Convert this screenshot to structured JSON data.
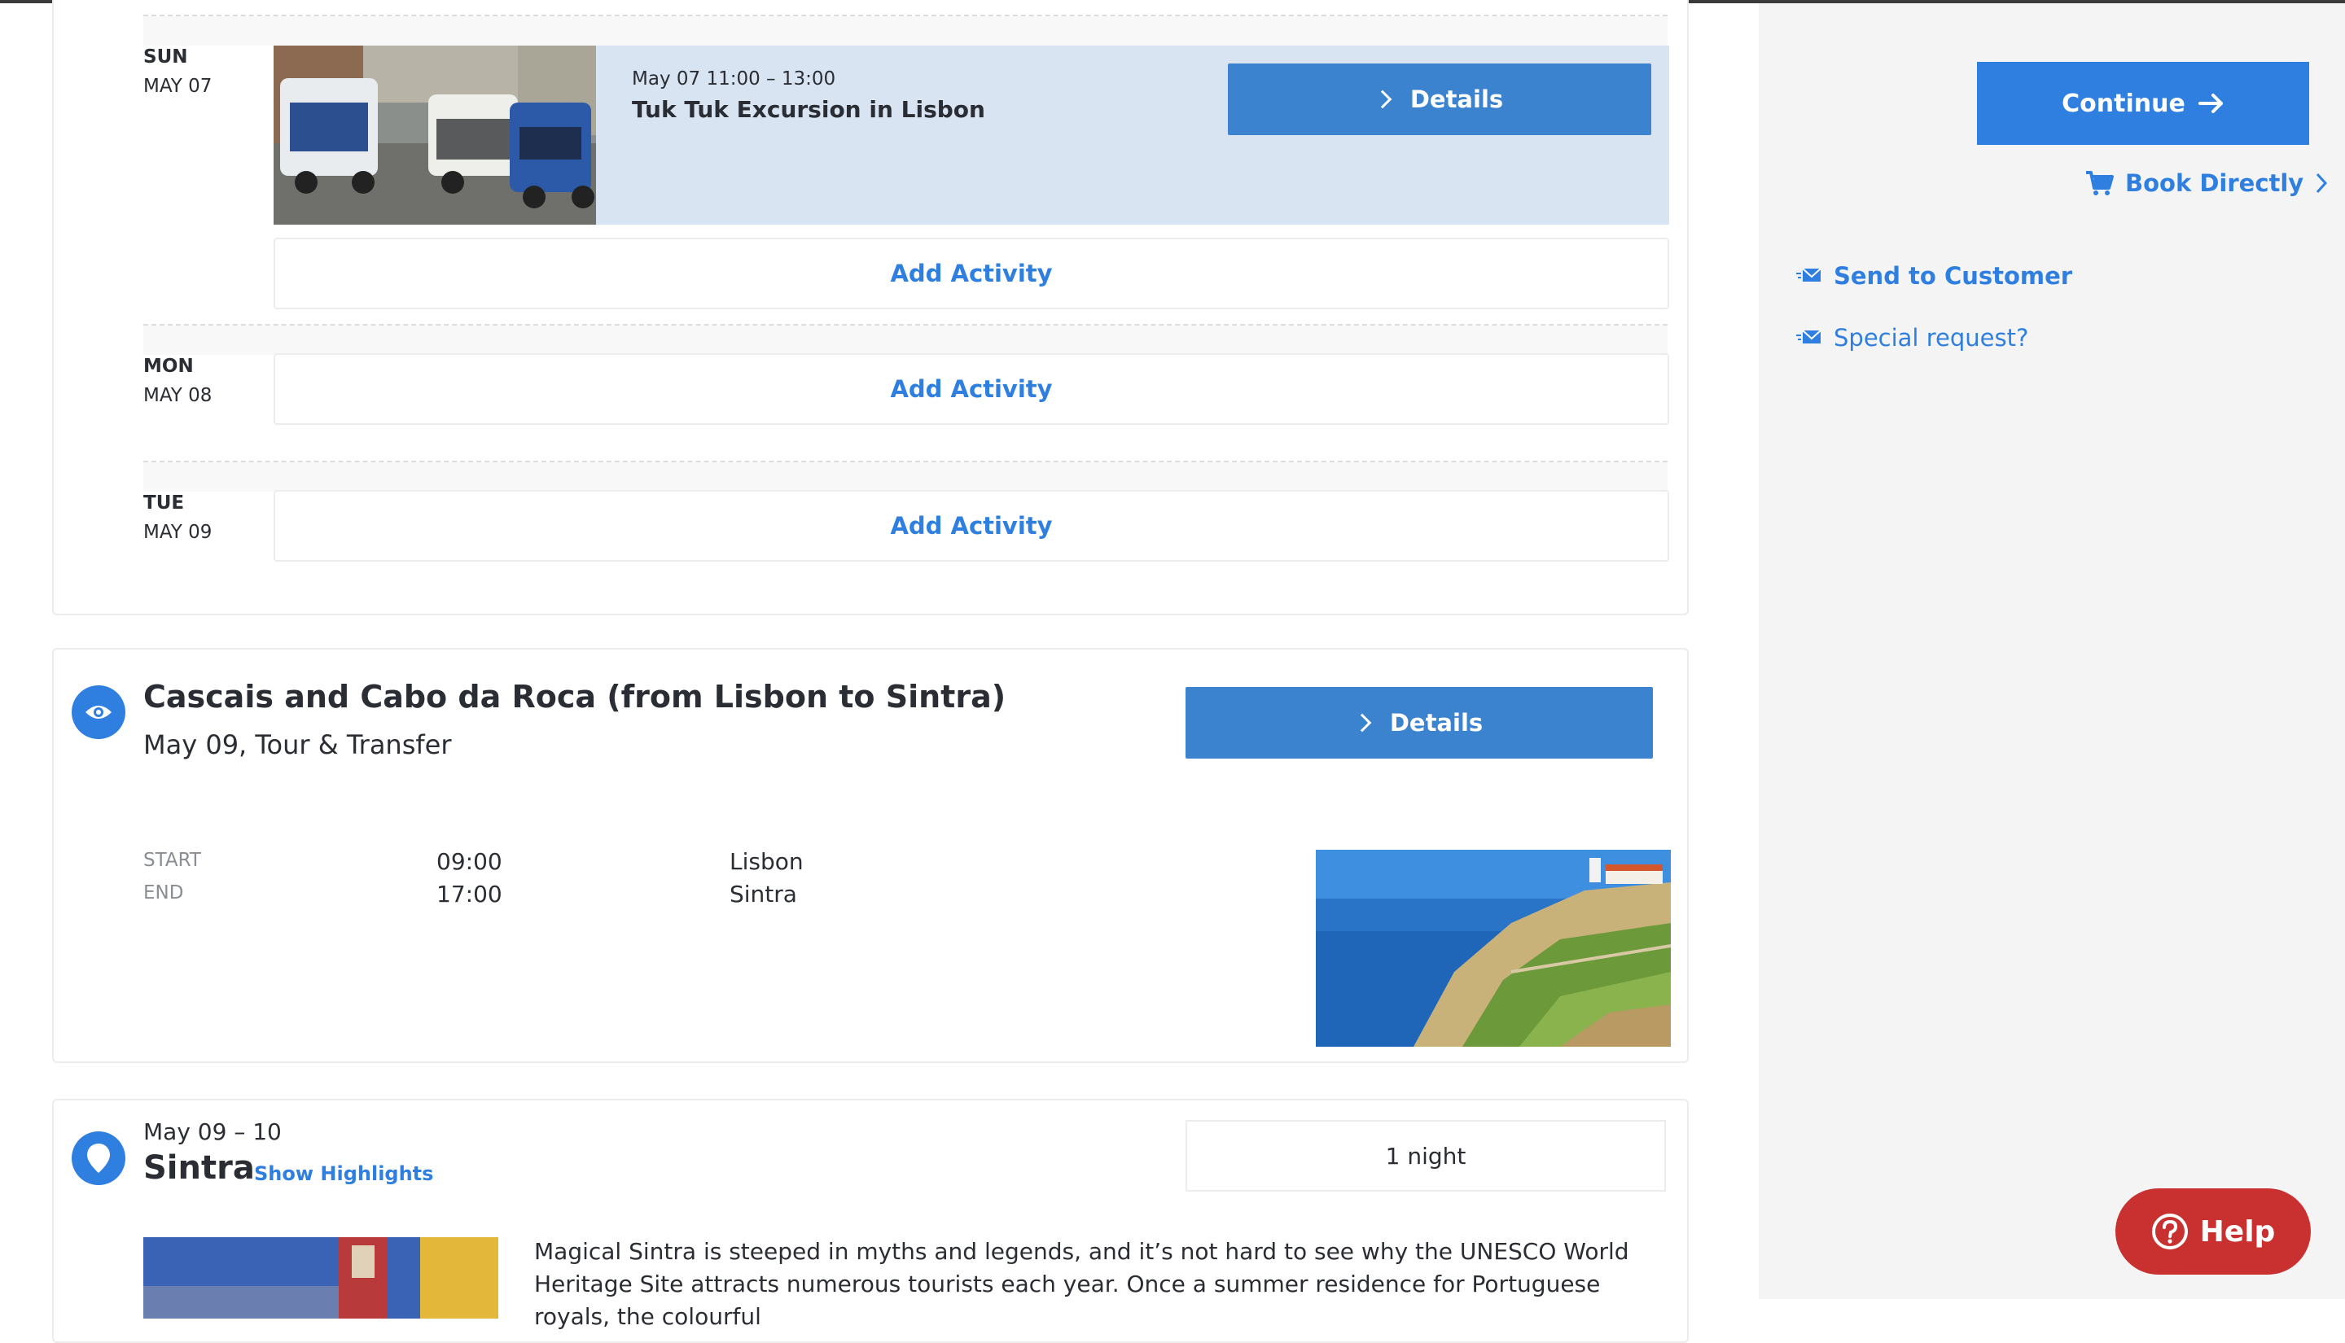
{
  "itinerary": {
    "days": [
      {
        "dow": "SUN",
        "date": "MAY 07"
      },
      {
        "dow": "MON",
        "date": "MAY 08"
      },
      {
        "dow": "TUE",
        "date": "MAY 09"
      }
    ],
    "activity": {
      "time": "May 07 11:00 – 13:00",
      "title": "Tuk Tuk Excursion in Lisbon",
      "details_label": "Details"
    },
    "add_activity_label": "Add Activity"
  },
  "tour": {
    "title": "Cascais and Cabo da Roca (from Lisbon to Sintra)",
    "subtitle": "May 09, Tour & Transfer",
    "details_label": "Details",
    "start_label": "START",
    "end_label": "END",
    "start_time": "09:00",
    "end_time": "17:00",
    "start_place": "Lisbon",
    "end_place": "Sintra"
  },
  "stay": {
    "dates": "May 09 – 10",
    "city": "Sintra",
    "highlights_label": "Show Highlights",
    "nights": "1 night",
    "description": "Magical Sintra is steeped in myths and legends, and it’s not hard to see why the UNESCO World Heritage Site attracts numerous tourists each year. Once a summer residence for Portuguese royals, the colourful"
  },
  "sidebar": {
    "continue_label": "Continue",
    "book_label": "Book Directly",
    "send_label": "Send to Customer",
    "special_label": "Special request?"
  },
  "help": {
    "label": "Help"
  },
  "colors": {
    "accent": "#2f7fe0",
    "details_button": "#3b82cf",
    "activity_bg": "#d8e4f2",
    "help_bg": "#c8312f"
  }
}
